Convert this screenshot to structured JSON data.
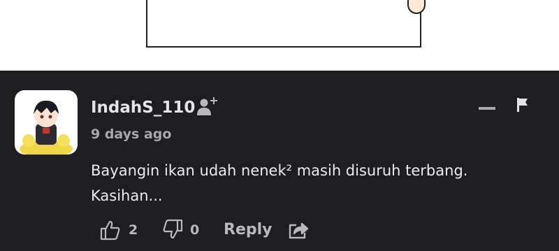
{
  "comment": {
    "username": "IndahS_110",
    "time": "9 days ago",
    "text_line1": "Bayangin ikan udah nenek² masih disuruh terbang.",
    "text_line2": "Kasihan...",
    "likes": "2",
    "dislikes": "0",
    "reply_label": "Reply"
  },
  "icons": {
    "follow": "add-user-icon",
    "collapse": "minus-icon",
    "report": "flag-icon",
    "like": "thumbs-up-icon",
    "dislike": "thumbs-down-icon",
    "share": "share-icon"
  },
  "colors": {
    "background": "#1e1d1f",
    "text_primary": "#e4e4e6",
    "text_secondary": "#a8a8ac"
  }
}
